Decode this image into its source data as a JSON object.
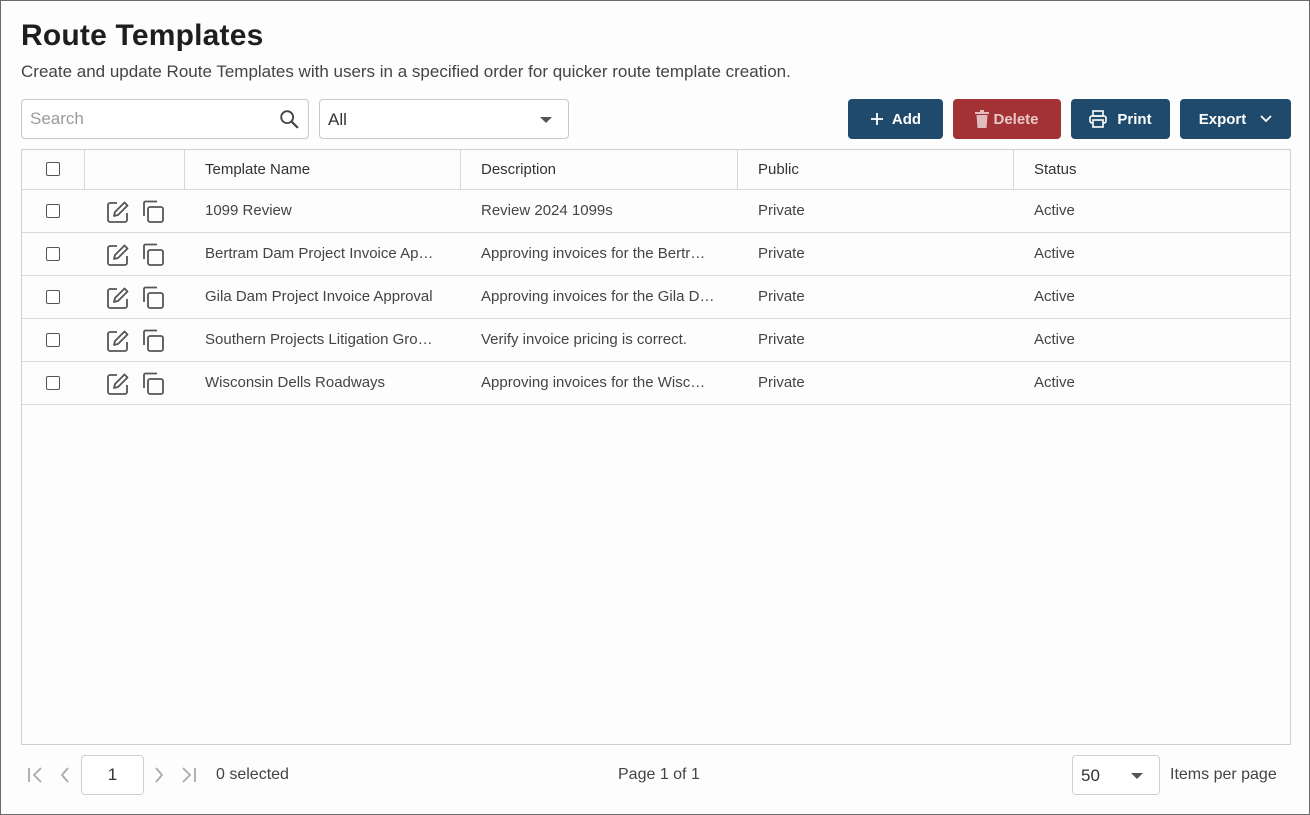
{
  "page": {
    "title": "Route Templates",
    "subtitle": "Create and update Route Templates with users in a specified order for quicker route template creation."
  },
  "toolbar": {
    "search_placeholder": "Search",
    "filter_value": "All",
    "add_label": "Add",
    "delete_label": "Delete",
    "print_label": "Print",
    "export_label": "Export"
  },
  "table": {
    "columns": [
      "Template Name",
      "Description",
      "Public",
      "Status"
    ],
    "rows": [
      {
        "name": "1099 Review",
        "description": "Review 2024 1099s",
        "public": "Private",
        "status": "Active"
      },
      {
        "name": "Bertram Dam Project Invoice Ap…",
        "description": "Approving invoices for the Bertr…",
        "public": "Private",
        "status": "Active"
      },
      {
        "name": "Gila Dam Project Invoice Approval",
        "description": "Approving invoices for the Gila D…",
        "public": "Private",
        "status": "Active"
      },
      {
        "name": "Southern Projects Litigation Gro…",
        "description": "Verify invoice pricing is correct.",
        "public": "Private",
        "status": "Active"
      },
      {
        "name": "Wisconsin Dells Roadways",
        "description": "Approving invoices for the Wisc…",
        "public": "Private",
        "status": "Active"
      }
    ]
  },
  "footer": {
    "page_number": "1",
    "selected_text": "0 selected",
    "page_info": "Page 1 of 1",
    "items_per_page": "50",
    "items_per_page_label": "Items per page"
  },
  "colors": {
    "primary_button": "#1f4a6b",
    "danger_button": "#a33234",
    "border": "#cfcfcf"
  },
  "icons": [
    "search-icon",
    "chevron-down-icon",
    "plus-icon",
    "trash-icon",
    "printer-icon",
    "edit-icon",
    "copy-icon",
    "first-page-icon",
    "prev-page-icon",
    "next-page-icon",
    "last-page-icon"
  ]
}
